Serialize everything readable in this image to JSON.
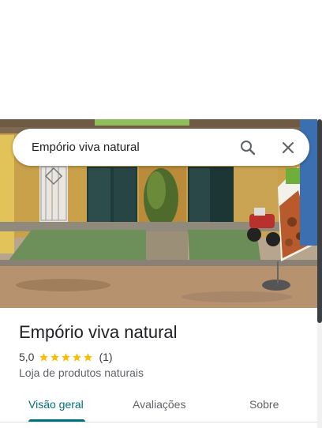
{
  "search": {
    "query": "Empório viva natural",
    "search_icon": "search-icon",
    "close_icon": "close-icon"
  },
  "place": {
    "name": "Empório viva natural",
    "rating": "5,0",
    "stars": 5,
    "review_count": "(1)",
    "category": "Loja de produtos naturais"
  },
  "tabs": [
    {
      "label": "Visão geral",
      "active": true
    },
    {
      "label": "Avaliações",
      "active": false
    },
    {
      "label": "Sobre",
      "active": false
    }
  ],
  "colors": {
    "accent": "#00707a",
    "star": "#fbbc04",
    "text_primary": "#202124",
    "text_secondary": "#5f6368"
  }
}
